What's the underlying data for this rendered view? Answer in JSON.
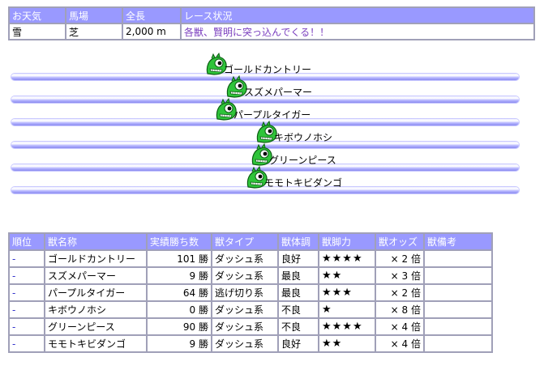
{
  "race_info": {
    "headers": [
      "お天気",
      "馬場",
      "全長",
      "レース状況"
    ],
    "values": {
      "weather": "雪",
      "track": "芝",
      "distance": "2,000 m",
      "status": "各獣、賢明に突っ込んでくる！！"
    }
  },
  "runners": [
    {
      "name": "ゴールドカントリー",
      "progress": 0.38
    },
    {
      "name": "スズメパーマー",
      "progress": 0.42
    },
    {
      "name": "パープルタイガー",
      "progress": 0.4
    },
    {
      "name": "キボウノホシ",
      "progress": 0.48
    },
    {
      "name": "グリーンピース",
      "progress": 0.47
    },
    {
      "name": "モモトキビダンゴ",
      "progress": 0.46
    }
  ],
  "table": {
    "headers": [
      "順位",
      "獣名称",
      "実績勝ち数",
      "獣タイプ",
      "獣体調",
      "獣脚力",
      "獣オッズ",
      "獣備考"
    ],
    "rows": [
      {
        "rank": "-",
        "name": "ゴールドカントリー",
        "wins": "101 勝",
        "type": "ダッシュ系",
        "condition": "良好",
        "power": "★★★★",
        "odds": "× 2 倍",
        "note": ""
      },
      {
        "rank": "-",
        "name": "スズメパーマー",
        "wins": "9 勝",
        "type": "ダッシュ系",
        "condition": "最良",
        "power": "★★",
        "odds": "× 3 倍",
        "note": ""
      },
      {
        "rank": "-",
        "name": "パープルタイガー",
        "wins": "64 勝",
        "type": "逃げ切り系",
        "condition": "最良",
        "power": "★★★",
        "odds": "× 2 倍",
        "note": ""
      },
      {
        "rank": "-",
        "name": "キボウノホシ",
        "wins": "0 勝",
        "type": "ダッシュ系",
        "condition": "不良",
        "power": "★",
        "odds": "× 8 倍",
        "note": ""
      },
      {
        "rank": "-",
        "name": "グリーンピース",
        "wins": "90 勝",
        "type": "ダッシュ系",
        "condition": "不良",
        "power": "★★★★",
        "odds": "× 4 倍",
        "note": ""
      },
      {
        "rank": "-",
        "name": "モモトキビダンゴ",
        "wins": "9 勝",
        "type": "ダッシュ系",
        "condition": "良好",
        "power": "★★",
        "odds": "× 4 倍",
        "note": ""
      }
    ]
  },
  "colors": {
    "header_bg": "#9999ff",
    "status_text": "#7b3fbf",
    "monster_green": "#2fc43a"
  },
  "icons": {
    "runner": "green-monster-icon"
  }
}
